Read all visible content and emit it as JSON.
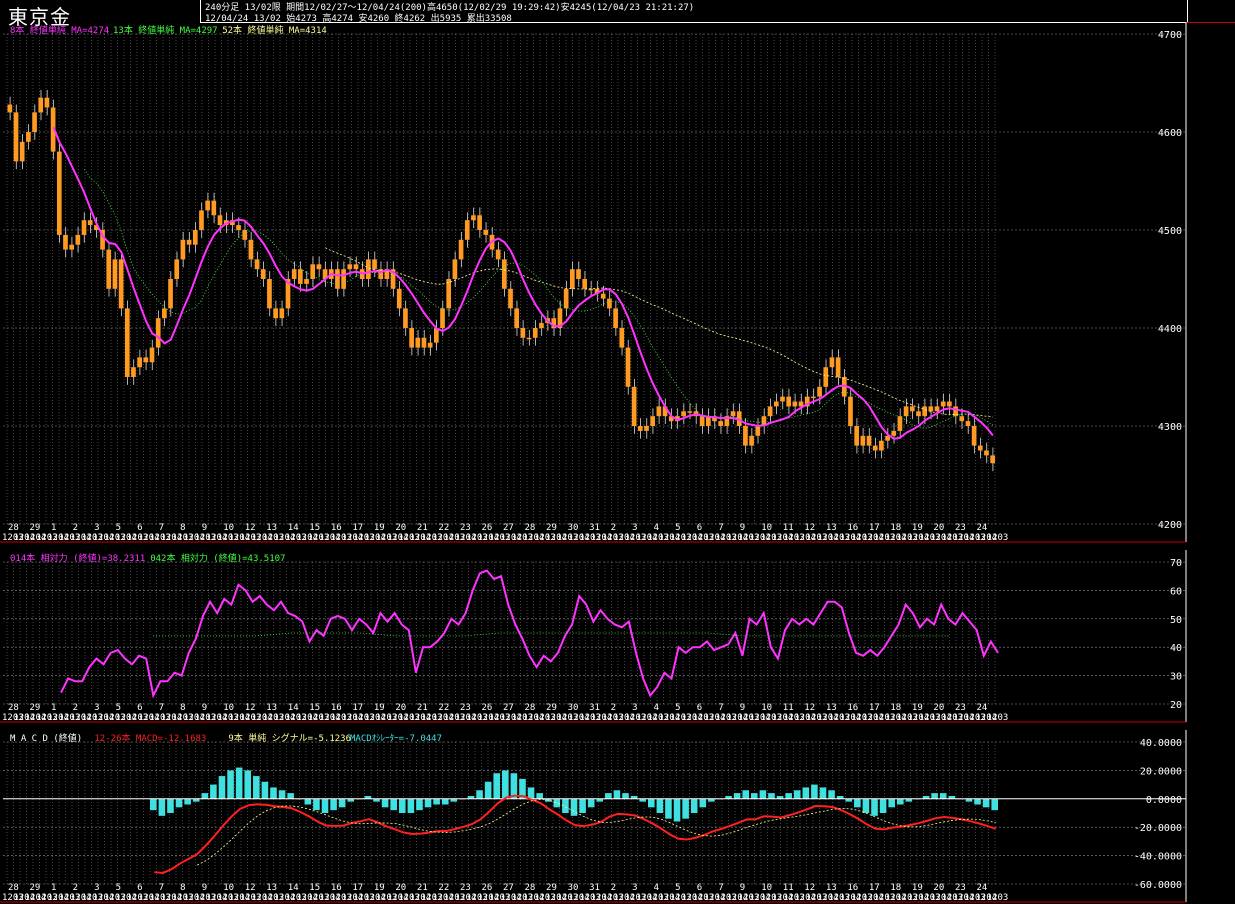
{
  "header": {
    "title": "東京金",
    "line1": "240分足 13/02限 期間12/02/27〜12/04/24(200)高4650(12/02/29 19:29:42)安4245(12/04/23 21:21:27)",
    "line2": "12/04/24 13/02 始4273 高4274 安4260 終4262 出5935 累出33508"
  },
  "colors": {
    "candle": "#ff9a22",
    "ma_short": "#ff33ff",
    "ma_mid": "#40ff40",
    "ma_long": "#ffff99",
    "rsi_short": "#ff33ff",
    "rsi_long": "#40ff40",
    "macd_line": "#ff2020",
    "signal": "#ffff99",
    "osc": "#40e0e0",
    "grid": "#d0d0d0"
  },
  "chart_data": [
    {
      "type": "candlestick",
      "name": "price",
      "legend": [
        {
          "text": "8本 終値単純 MA=4274",
          "color": "#ff33ff"
        },
        {
          "text": "13本 終値単純 MA=4297",
          "color": "#40ff40"
        },
        {
          "text": "52本 終値単純 MA=4314",
          "color": "#ffff99"
        }
      ],
      "ylim": [
        4200,
        4700
      ],
      "yticks": [
        "4700",
        "4600",
        "4500",
        "4400",
        "4300",
        "4200"
      ],
      "closes": [
        4620,
        4570,
        4590,
        4600,
        4620,
        4635,
        4625,
        4580,
        4495,
        4480,
        4485,
        4495,
        4510,
        4505,
        4500,
        4480,
        4440,
        4470,
        4420,
        4350,
        4360,
        4370,
        4365,
        4380,
        4410,
        4420,
        4450,
        4470,
        4490,
        4485,
        4500,
        4520,
        4530,
        4515,
        4505,
        4510,
        4505,
        4500,
        4490,
        4470,
        4460,
        4450,
        4420,
        4410,
        4420,
        4450,
        4460,
        4445,
        4450,
        4465,
        4460,
        4450,
        4460,
        4440,
        4460,
        4465,
        4460,
        4450,
        4470,
        4460,
        4450,
        4460,
        4440,
        4420,
        4400,
        4380,
        4390,
        4380,
        4385,
        4400,
        4420,
        4450,
        4470,
        4490,
        4510,
        4515,
        4500,
        4495,
        4480,
        4470,
        4440,
        4420,
        4400,
        4390,
        4390,
        4400,
        4405,
        4410,
        4400,
        4420,
        4440,
        4460,
        4450,
        4440,
        4440,
        4435,
        4430,
        4420,
        4400,
        4380,
        4340,
        4300,
        4295,
        4300,
        4310,
        4320,
        4310,
        4305,
        4310,
        4315,
        4315,
        4310,
        4300,
        4310,
        4305,
        4300,
        4310,
        4315,
        4300,
        4280,
        4290,
        4300,
        4310,
        4320,
        4325,
        4330,
        4320,
        4325,
        4320,
        4330,
        4330,
        4340,
        4360,
        4370,
        4350,
        4330,
        4300,
        4280,
        4290,
        4280,
        4275,
        4285,
        4290,
        4295,
        4310,
        4320,
        4315,
        4310,
        4320,
        4315,
        4320,
        4325,
        4320,
        4310,
        4305,
        4300,
        4280,
        4275,
        4270,
        4262
      ]
    },
    {
      "type": "line",
      "name": "rsi",
      "legend": [
        {
          "text": "014本 相対力 (終値)=38.2311",
          "color": "#ff33ff"
        },
        {
          "text": "042本 相対力 (終値)=43.5107",
          "color": "#40ff40"
        }
      ],
      "ylim": [
        20,
        70
      ],
      "yticks": [
        "70",
        "60",
        "50",
        "40",
        "30",
        "20"
      ],
      "series": [
        {
          "values": [
            24,
            29,
            28,
            28,
            33,
            36,
            34,
            38,
            39,
            36,
            34,
            37,
            36,
            23,
            28,
            28,
            31,
            30,
            38,
            43,
            51,
            56,
            52,
            57,
            55,
            62,
            60,
            56,
            58,
            55,
            53,
            56,
            52,
            51,
            49,
            42,
            46,
            44,
            50,
            51,
            50,
            46,
            50,
            48,
            45,
            52,
            49,
            52,
            48,
            46,
            31,
            40,
            40,
            42,
            45,
            50,
            48,
            52,
            60,
            66,
            67,
            64,
            65,
            55,
            48,
            43,
            37,
            33,
            37,
            35,
            38,
            44,
            48,
            58,
            55,
            49,
            53,
            50,
            48,
            47,
            49,
            38,
            29,
            23,
            26,
            31,
            29,
            40,
            38,
            40,
            40,
            42,
            39,
            40,
            41,
            45,
            37,
            50,
            48,
            52,
            40,
            36,
            46,
            50,
            48,
            50,
            48,
            52,
            56,
            56,
            54,
            45,
            38,
            37,
            39,
            37,
            40,
            44,
            48,
            55,
            52,
            47,
            50,
            48,
            55,
            50,
            48,
            52,
            49,
            46,
            37,
            42,
            38
          ]
        },
        {
          "values": [
            44,
            44,
            44,
            44,
            45,
            45,
            45,
            44,
            44,
            44,
            45,
            45,
            45,
            45,
            45,
            45,
            45,
            44,
            44,
            44,
            44,
            44,
            44,
            44
          ]
        }
      ]
    },
    {
      "type": "bar",
      "name": "macd",
      "legend": [
        {
          "text": "M A C D (終値)",
          "color": "#ffffff"
        },
        {
          "text": "12-26本 MACD=-12.1683",
          "color": "#ff2020"
        },
        {
          "text": "9本 単純 シグナル=-5.1236",
          "color": "#ffff99"
        },
        {
          "text": "MACDｵｼﾚｰﾀｰ=-7.0447",
          "color": "#40e0e0"
        }
      ],
      "ylim": [
        -60,
        40
      ],
      "yticks": [
        "40.0000",
        "20.0000",
        "0.0000",
        "-20.0000",
        "-40.0000",
        "-60.0000"
      ],
      "oscillator": [
        -8,
        -12,
        -10,
        -6,
        -4,
        -2,
        4,
        10,
        16,
        20,
        22,
        20,
        16,
        12,
        8,
        6,
        4,
        0,
        -4,
        -8,
        -10,
        -8,
        -6,
        -2,
        0,
        2,
        -2,
        -6,
        -8,
        -10,
        -10,
        -8,
        -6,
        -4,
        -4,
        -2,
        0,
        2,
        6,
        12,
        18,
        20,
        18,
        14,
        8,
        4,
        -2,
        -6,
        -10,
        -12,
        -10,
        -6,
        -2,
        4,
        6,
        4,
        2,
        -2,
        -6,
        -10,
        -14,
        -16,
        -14,
        -10,
        -6,
        -2,
        0,
        2,
        4,
        6,
        4,
        6,
        4,
        2,
        4,
        6,
        8,
        10,
        8,
        6,
        2,
        -2,
        -6,
        -10,
        -12,
        -10,
        -6,
        -4,
        -2,
        0,
        2,
        4,
        4,
        2,
        0,
        -2,
        -4,
        -6,
        -8
      ]
    }
  ],
  "date_axis": {
    "day_labels": [
      "28",
      "29",
      "1",
      "2",
      "3",
      "5",
      "6",
      "7",
      "8",
      "9",
      "10",
      "12",
      "13",
      "14",
      "15",
      "16",
      "17",
      "19",
      "20",
      "21",
      "22",
      "23",
      "26",
      "27",
      "28",
      "29",
      "30",
      "31",
      "2",
      "3",
      "4",
      "5",
      "6",
      "7",
      "9",
      "10",
      "11",
      "12",
      "13",
      "16",
      "17",
      "18",
      "19",
      "20",
      "23",
      "24"
    ],
    "month_labels": [
      "1203",
      "1204",
      "1204",
      "1203",
      "1204",
      "1203",
      "1204",
      "1203",
      "1204",
      "1203",
      "1204",
      "1203",
      "1204",
      "1203",
      "1204",
      "1203",
      "1204",
      "1203",
      "1204",
      "1203",
      "1204",
      "1203",
      "1204",
      "1203",
      "1204",
      "1203",
      "1204",
      "1203",
      "1204",
      "1203",
      "1204",
      "1203",
      "1204",
      "1203",
      "1204",
      "1203",
      "1204",
      "1203",
      "1204",
      "1203",
      "1204",
      "1203",
      "1204",
      "1203",
      "1204",
      "1203",
      "1204",
      "1203",
      "1204",
      "1203",
      "1204",
      "1203",
      "1204",
      "1203",
      "1204",
      "1203",
      "1204",
      "1203",
      "1204",
      "1203",
      "1204",
      "1203",
      "1204",
      "1203",
      "1204",
      "1203",
      "1204",
      "1203",
      "1204",
      "1203",
      "1204",
      "1203",
      "1204",
      "1203",
      "1204",
      "1203",
      "1204",
      "1203",
      "1204",
      "1203",
      "1204",
      "1203",
      "1204",
      "1203",
      "1204",
      "1203",
      "1204",
      "1203"
    ]
  }
}
